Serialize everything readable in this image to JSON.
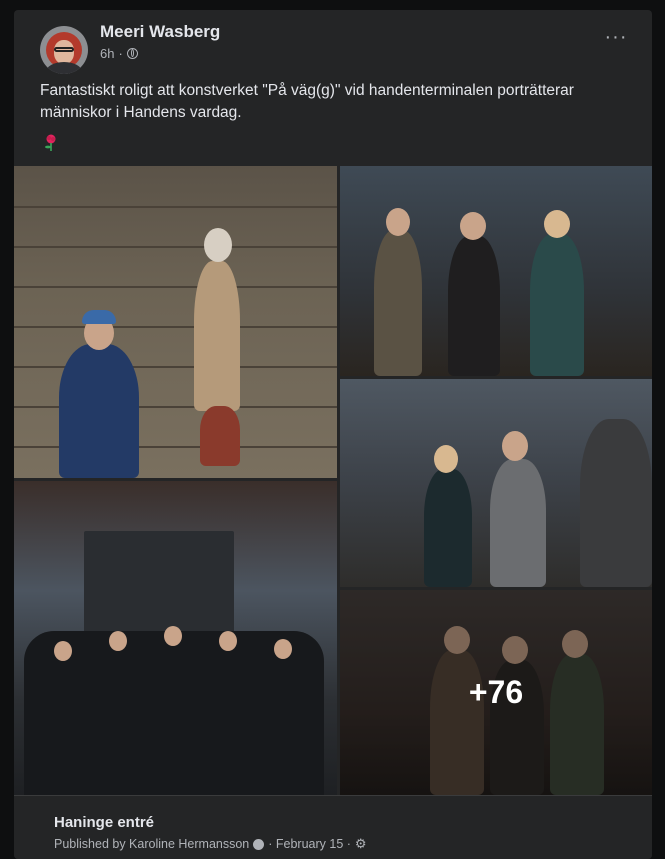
{
  "post": {
    "author": "Meeri Wasberg",
    "time": "6h",
    "meta_separator": "·",
    "text": "Fantastiskt roligt att konstverket \"På väg(g)\" vid handenterminalen porträtterar människor i Handens vardag.",
    "emoji": "rose",
    "more_button_label": "···",
    "more_photos_count": "+76"
  },
  "footer": {
    "page_name": "Haninge entré",
    "published_by": "Published by Karoline Hermansson",
    "date": "· February 15 ·"
  },
  "colors": {
    "card_bg": "#242526",
    "text_primary": "#e4e6eb",
    "text_secondary": "#b0b3b8"
  },
  "icons": [
    "globe-icon",
    "more-icon",
    "rose-icon",
    "info-icon",
    "gear-icon"
  ]
}
